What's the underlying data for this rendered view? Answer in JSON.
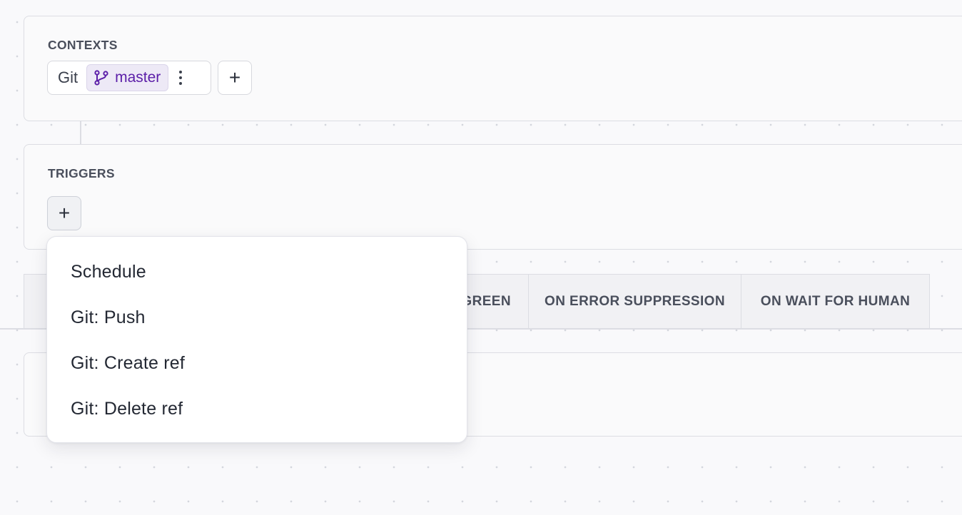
{
  "colors": {
    "background": "#f9f9fb",
    "card_border": "#dcdde3",
    "branch_accent": "#5b1ea8",
    "branch_badge_bg": "#ede9f6"
  },
  "contexts": {
    "title": "CONTEXTS",
    "chip_label": "Git",
    "branch": "master",
    "branch_icon": "git-branch-icon",
    "menu_icon": "kebab-menu-icon",
    "add_label": "+"
  },
  "triggers": {
    "title": "TRIGGERS",
    "add_label": "+"
  },
  "tabs": [
    {
      "label": "GREEN"
    },
    {
      "label": "ON ERROR SUPPRESSION"
    },
    {
      "label": "ON WAIT FOR HUMAN"
    }
  ],
  "dropdown": {
    "items": [
      {
        "label": "Schedule"
      },
      {
        "label": "Git: Push"
      },
      {
        "label": "Git: Create ref"
      },
      {
        "label": "Git: Delete ref"
      }
    ]
  }
}
